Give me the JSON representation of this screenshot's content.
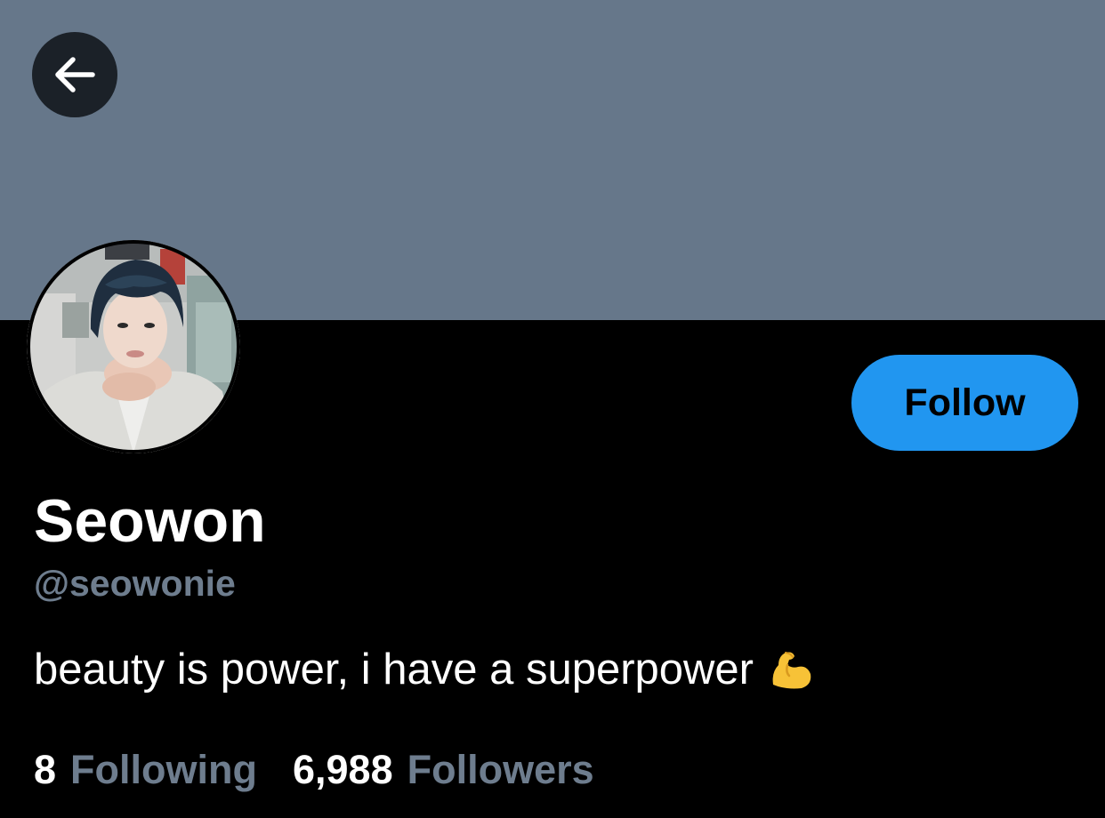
{
  "colors": {
    "banner": "#66778a",
    "background": "#000000",
    "follow_button": "#2196f0",
    "muted_text": "#6e7d8e"
  },
  "header": {
    "back_icon": "arrow-left-icon"
  },
  "profile": {
    "display_name": "Seowon",
    "handle": "@seowonie",
    "bio": "beauty is power, i have a superpower",
    "bio_emoji": "flexed-biceps-icon",
    "follow_label": "Follow"
  },
  "stats": {
    "following_count": "8",
    "following_label": "Following",
    "followers_count": "6,988",
    "followers_label": "Followers"
  }
}
